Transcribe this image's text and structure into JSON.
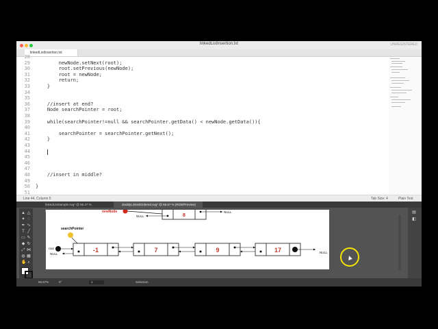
{
  "editor": {
    "title": "linkedListInsertion.txt",
    "unregistered": "UNREGISTERED",
    "tab": "linkedListInsertion.txt",
    "lines": [
      {
        "num": "28",
        "code": ""
      },
      {
        "num": "29",
        "code": "        newNode.setNext(root);"
      },
      {
        "num": "30",
        "code": "        root.setPrevious(newNode);"
      },
      {
        "num": "31",
        "code": "        root = newNode;"
      },
      {
        "num": "32",
        "code": "        return;"
      },
      {
        "num": "33",
        "code": "    }"
      },
      {
        "num": "34",
        "code": ""
      },
      {
        "num": "35",
        "code": ""
      },
      {
        "num": "36",
        "code": "    //insert at end?"
      },
      {
        "num": "37",
        "code": "    Node searchPointer = root;"
      },
      {
        "num": "38",
        "code": ""
      },
      {
        "num": "39",
        "code": "    while(searchPointer!=null && searchPointer.getData() < newNode.getData()){"
      },
      {
        "num": "40",
        "code": ""
      },
      {
        "num": "41",
        "code": "        searchPointer = searchPointer.getNext();"
      },
      {
        "num": "42",
        "code": "    }"
      },
      {
        "num": "43",
        "code": ""
      },
      {
        "num": "44",
        "code": ""
      },
      {
        "num": "45",
        "code": ""
      },
      {
        "num": "46",
        "code": ""
      },
      {
        "num": "47",
        "code": ""
      },
      {
        "num": "48",
        "code": "    //insert in middle?"
      },
      {
        "num": "49",
        "code": ""
      },
      {
        "num": "50",
        "code": "}"
      },
      {
        "num": "51",
        "code": ""
      }
    ],
    "status_left": "Line 44, Column 5",
    "tab_size": "Tab Size: 4",
    "syntax": "Plain Text"
  },
  "illustrator": {
    "tabs": [
      "linkedListSample.svg* @ 56.47 % (RGB/Preview)",
      "doublyLinkedOrdered.svg* @ 66.67 % (RGB/Preview)"
    ],
    "zoom": "66.67%",
    "artboard_num": "1",
    "tool_name": "Selection",
    "diagram": {
      "new_node_label": "newNode",
      "new_node_value": "8",
      "search_pointer_label": "searchPointer",
      "root_label": "root",
      "null_label": "NULL",
      "values": [
        "-1",
        "7",
        "9",
        "17"
      ]
    }
  }
}
